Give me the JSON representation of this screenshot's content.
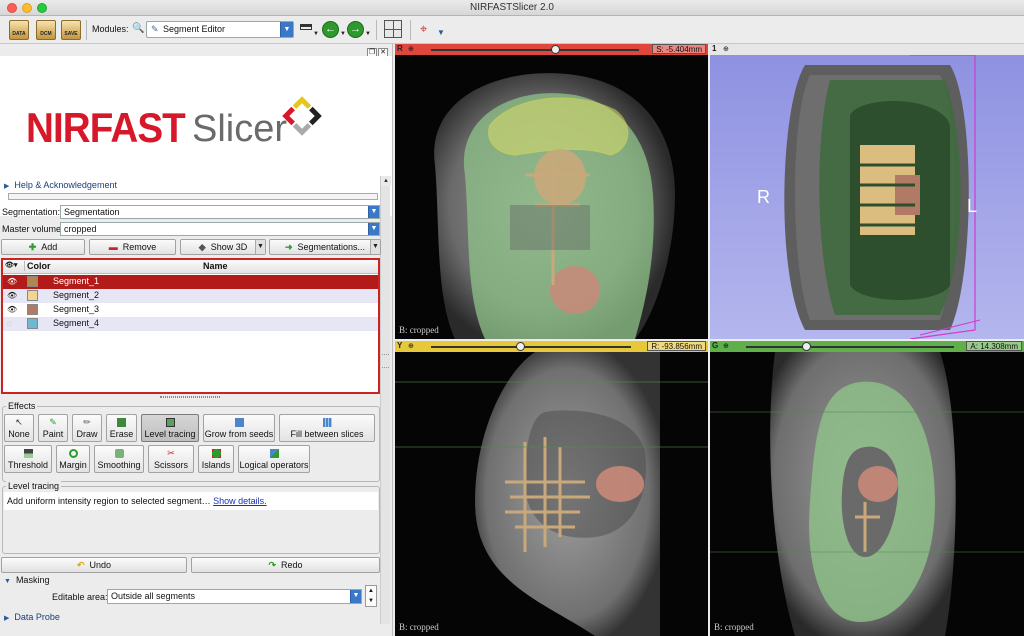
{
  "window": {
    "title": "NIRFASTSlicer 2.0"
  },
  "toolbar": {
    "data_label": "DATA",
    "dcm_label": "DCM",
    "save_label": "SAVE",
    "modules_label": "Modules:",
    "module_selected": "Segment Editor"
  },
  "logo": {
    "part1": "NIRFAST",
    "part2": "Slicer"
  },
  "sections": {
    "help": "Help & Acknowledgement",
    "data_probe": "Data Probe"
  },
  "segmentation": {
    "label": "Segmentation:",
    "value": "Segmentation",
    "master_label": "Master volume:",
    "master_value": "cropped"
  },
  "buttons": {
    "add": "Add",
    "remove": "Remove",
    "show3d": "Show 3D",
    "segmentations": "Segmentations...",
    "undo": "Undo",
    "redo": "Redo"
  },
  "segment_table": {
    "col_color": "Color",
    "col_name": "Name",
    "rows": [
      {
        "name": "Segment_1",
        "color": "#b2864f"
      },
      {
        "name": "Segment_2",
        "color": "#f1d691"
      },
      {
        "name": "Segment_3",
        "color": "#b07a66"
      },
      {
        "name": "Segment_4",
        "color": "#6fb8d2"
      }
    ]
  },
  "effects": {
    "title": "Effects",
    "row1": [
      "None",
      "Paint",
      "Draw",
      "Erase",
      "Level tracing",
      "Grow from seeds",
      "Fill between slices"
    ],
    "row2": [
      "Threshold",
      "Margin",
      "Smoothing",
      "Scissors",
      "Islands",
      "Logical operators"
    ],
    "active": "Level tracing"
  },
  "level_tracing": {
    "title": "Level tracing",
    "description": "Add uniform intensity region to selected segment…",
    "link": "Show details."
  },
  "masking": {
    "title": "Masking",
    "editable_label": "Editable area:",
    "editable_value": "Outside all segments"
  },
  "views": {
    "red": {
      "label": "R",
      "value": "S: -5.404mm",
      "caption": "B: cropped",
      "color": "#e0463c"
    },
    "yellow": {
      "label": "Y",
      "value": "R: -93.856mm",
      "caption": "B: cropped",
      "color": "#e6c83a"
    },
    "green": {
      "label": "G",
      "value": "A: 14.308mm",
      "caption": "B: cropped",
      "color": "#5fb04a"
    },
    "three_d": {
      "label": "1",
      "left_marker": "R",
      "right_marker": "L"
    }
  },
  "colors": {
    "tissue_green": "#8fc28a",
    "tumor_tan": "#c9a97a",
    "tumor_pink": "#c9897a",
    "selection_red": "#b31b1b"
  }
}
